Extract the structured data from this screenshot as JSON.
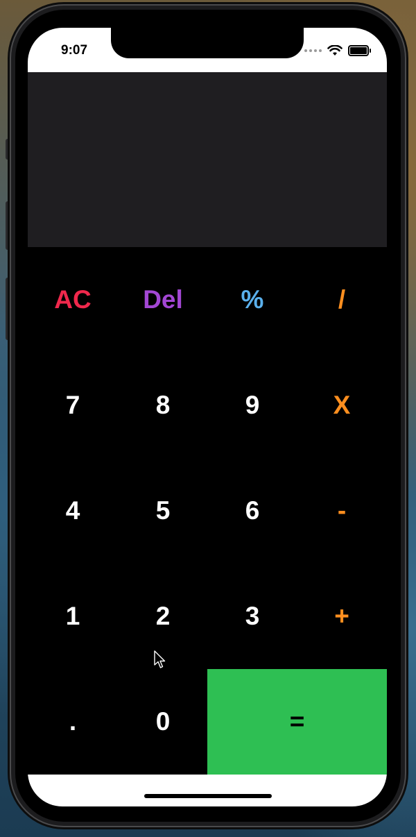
{
  "status_bar": {
    "time": "9:07",
    "wifi_icon": "wifi-icon",
    "battery_icon": "battery-icon"
  },
  "display": {
    "value": ""
  },
  "keypad": {
    "row1": [
      "AC",
      "Del",
      "%",
      "/"
    ],
    "row2": [
      "7",
      "8",
      "9",
      "X"
    ],
    "row3": [
      "4",
      "5",
      "6",
      "-"
    ],
    "row4": [
      "1",
      "2",
      "3",
      "+"
    ],
    "row5": [
      ".",
      "0",
      "="
    ]
  },
  "colors": {
    "ac": "#f0284c",
    "del": "#a347d4",
    "percent": "#5ab0ec",
    "operator": "#ff8f1f",
    "equals_bg": "#2ebf53",
    "display_bg": "#1f1e21"
  }
}
